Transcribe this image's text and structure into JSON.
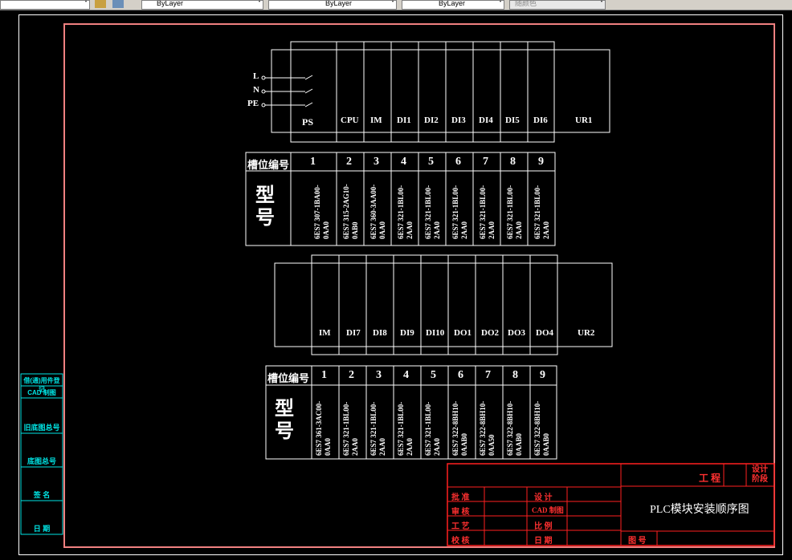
{
  "toolbar": {
    "layer_value": "ByLayer",
    "linetype_value": "ByLayer",
    "lineweight_value": "ByLayer",
    "color_value": "随颜色"
  },
  "rack1": {
    "power_terminals": [
      "L",
      "N",
      "PE"
    ],
    "slots": [
      "PS",
      "CPU",
      "IM",
      "DI1",
      "DI2",
      "DI3",
      "DI4",
      "DI5",
      "DI6"
    ],
    "rail": "UR1"
  },
  "table1": {
    "header": "槽位编号",
    "type_label": "型号",
    "numbers": [
      "1",
      "2",
      "3",
      "4",
      "5",
      "6",
      "7",
      "8",
      "9"
    ],
    "models": [
      "6ES7 307-1BA00-0AA0",
      "6ES7 315-2AG10-0AB0",
      "6ES7 360-3AA00-0AA0",
      "6ES7 321-1BL00-2AA0",
      "6ES7 321-1BL00-2AA0",
      "6ES7 321-1BL00-2AA0",
      "6ES7 321-1BL00-2AA0",
      "6ES7 321-1BL00-2AA0",
      "6ES7 321-1BL00-2AA0"
    ]
  },
  "rack2": {
    "slots": [
      "IM",
      "DI7",
      "DI8",
      "DI9",
      "DI10",
      "DO1",
      "DO2",
      "DO3",
      "DO4"
    ],
    "rail": "UR2"
  },
  "table2": {
    "header": "槽位编号",
    "type_label": "型号",
    "numbers": [
      "1",
      "2",
      "3",
      "4",
      "5",
      "6",
      "7",
      "8",
      "9"
    ],
    "models": [
      "6ES7 361-3AC00-0AA0",
      "6ES7 321-1BL00-2AA0",
      "6ES7 321-1BL00-2AA0",
      "6ES7 321-1BL00-2AA0",
      "6ES7 321-1BL00-2AA0",
      "6ES7 322-8BH10-0AAB0",
      "6ES7 322-8BH10-0AA50",
      "6ES7 322-8BH10-0AAB0",
      "6ES7 322-8BH10-0AAB0"
    ]
  },
  "side_panel": {
    "items": [
      "借(通)用件登记",
      "CAD 制图",
      "旧底图总号",
      "底图总号",
      "签 名",
      "日 期"
    ]
  },
  "title_block": {
    "project": "工 程",
    "stage": "设计阶段",
    "drawing_title": "PLC模块安装顺序图",
    "left_labels": [
      "批 准",
      "审 核",
      "工 艺",
      "校 核"
    ],
    "mid_labels": [
      "设 计",
      "CAD 制图",
      "比 例",
      "日 期"
    ],
    "drawing_no_label": "图 号"
  }
}
